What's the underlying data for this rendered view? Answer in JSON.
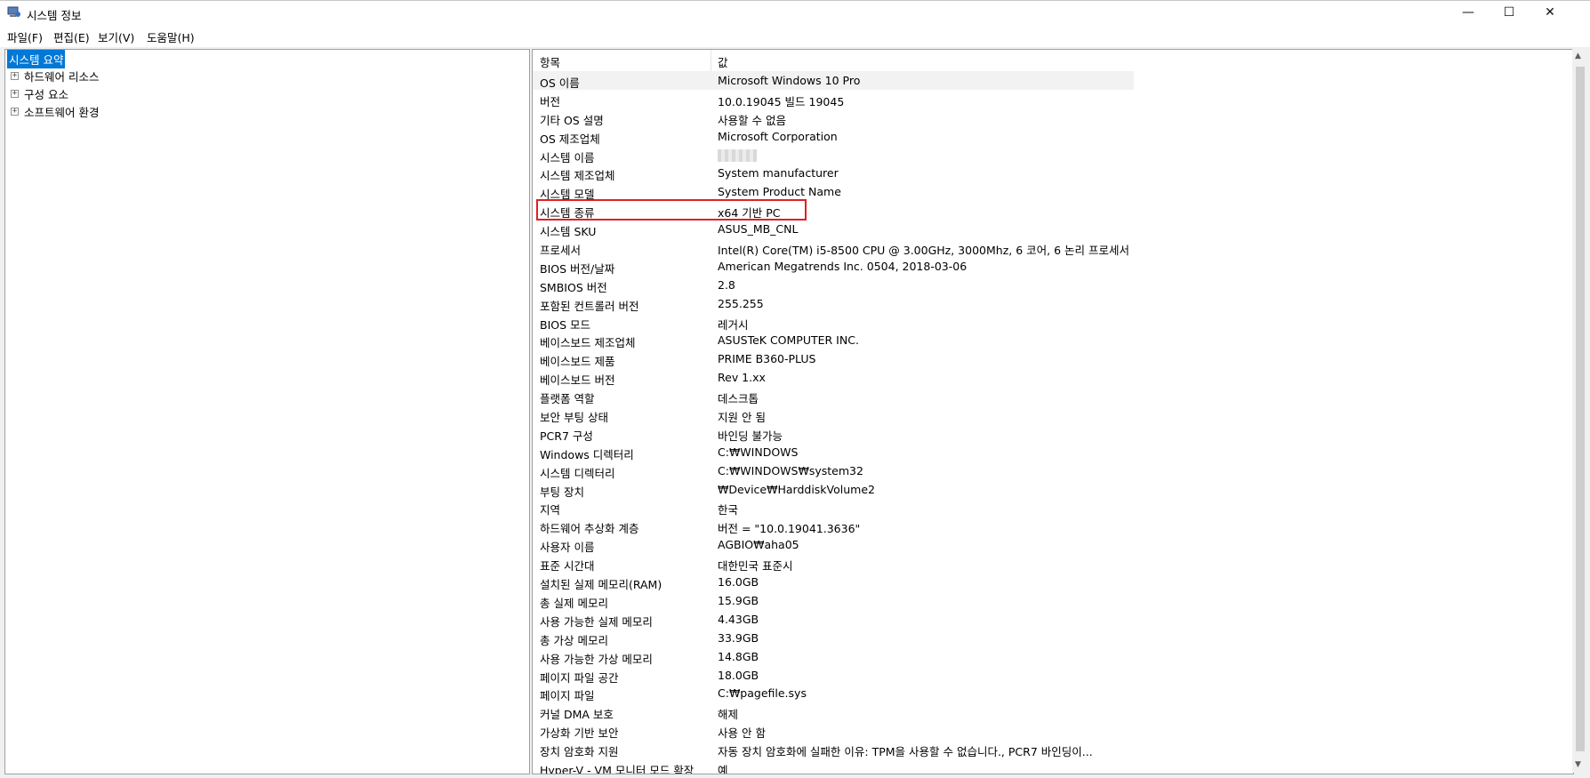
{
  "window": {
    "title": "시스템 정보",
    "minimize": "—",
    "maximize": "☐",
    "close": "✕"
  },
  "menu": [
    "파일(F)",
    "편집(E)",
    "보기(V)",
    "도움말(H)"
  ],
  "tree": {
    "root": "시스템 요약",
    "children": [
      "하드웨어 리소스",
      "구성 요소",
      "소프트웨어 환경"
    ],
    "expander": "+"
  },
  "list": {
    "col_item": "항목",
    "col_value": "값",
    "rows": [
      {
        "k": "OS 이름",
        "v": "Microsoft Windows 10 Pro"
      },
      {
        "k": "버전",
        "v": "10.0.19045 빌드 19045"
      },
      {
        "k": "기타 OS 설명",
        "v": "사용할 수 없음"
      },
      {
        "k": "OS 제조업체",
        "v": "Microsoft Corporation"
      },
      {
        "k": "시스템 이름",
        "v": ""
      },
      {
        "k": "시스템 제조업체",
        "v": "System manufacturer"
      },
      {
        "k": "시스템 모델",
        "v": "System Product Name"
      },
      {
        "k": "시스템 종류",
        "v": "x64 기반 PC"
      },
      {
        "k": "시스템 SKU",
        "v": "ASUS_MB_CNL"
      },
      {
        "k": "프로세서",
        "v": "Intel(R) Core(TM) i5-8500 CPU @ 3.00GHz, 3000Mhz, 6 코어, 6 논리 프로세서"
      },
      {
        "k": "BIOS 버전/날짜",
        "v": "American Megatrends Inc. 0504, 2018-03-06"
      },
      {
        "k": "SMBIOS 버전",
        "v": "2.8"
      },
      {
        "k": "포함된 컨트롤러 버전",
        "v": "255.255"
      },
      {
        "k": "BIOS 모드",
        "v": "레거시"
      },
      {
        "k": "베이스보드 제조업체",
        "v": "ASUSTeK COMPUTER INC."
      },
      {
        "k": "베이스보드 제품",
        "v": "PRIME B360-PLUS"
      },
      {
        "k": "베이스보드 버전",
        "v": "Rev 1.xx"
      },
      {
        "k": "플랫폼 역할",
        "v": "데스크톱"
      },
      {
        "k": "보안 부팅 상태",
        "v": "지원 안 됨"
      },
      {
        "k": "PCR7 구성",
        "v": "바인딩 불가능"
      },
      {
        "k": "Windows 디렉터리",
        "v": "C:₩WINDOWS"
      },
      {
        "k": "시스템 디렉터리",
        "v": "C:₩WINDOWS₩system32"
      },
      {
        "k": "부팅 장치",
        "v": "₩Device₩HarddiskVolume2"
      },
      {
        "k": "지역",
        "v": "한국"
      },
      {
        "k": "하드웨어 추상화 계층",
        "v": "버전 = \"10.0.19041.3636\""
      },
      {
        "k": "사용자 이름",
        "v": "AGBIO₩aha05"
      },
      {
        "k": "표준 시간대",
        "v": "대한민국 표준시"
      },
      {
        "k": "설치된 실제 메모리(RAM)",
        "v": "16.0GB"
      },
      {
        "k": "총 실제 메모리",
        "v": "15.9GB"
      },
      {
        "k": "사용 가능한 실제 메모리",
        "v": "4.43GB"
      },
      {
        "k": "총 가상 메모리",
        "v": "33.9GB"
      },
      {
        "k": "사용 가능한 가상 메모리",
        "v": "14.8GB"
      },
      {
        "k": "페이지 파일 공간",
        "v": "18.0GB"
      },
      {
        "k": "페이지 파일",
        "v": "C:₩pagefile.sys"
      },
      {
        "k": "커널 DMA 보호",
        "v": "해제"
      },
      {
        "k": "가상화 기반 보안",
        "v": "사용 안 함"
      },
      {
        "k": "장치 암호화 지원",
        "v": "자동 장치 암호화에 실패한 이유: TPM을 사용할 수 없습니다., PCR7 바인딩이..."
      },
      {
        "k": "Hyper-V - VM 모니터 모드 확장",
        "v": "예"
      }
    ]
  },
  "colors": {
    "selection": "#0078d7",
    "highlight_border": "#e02020"
  }
}
